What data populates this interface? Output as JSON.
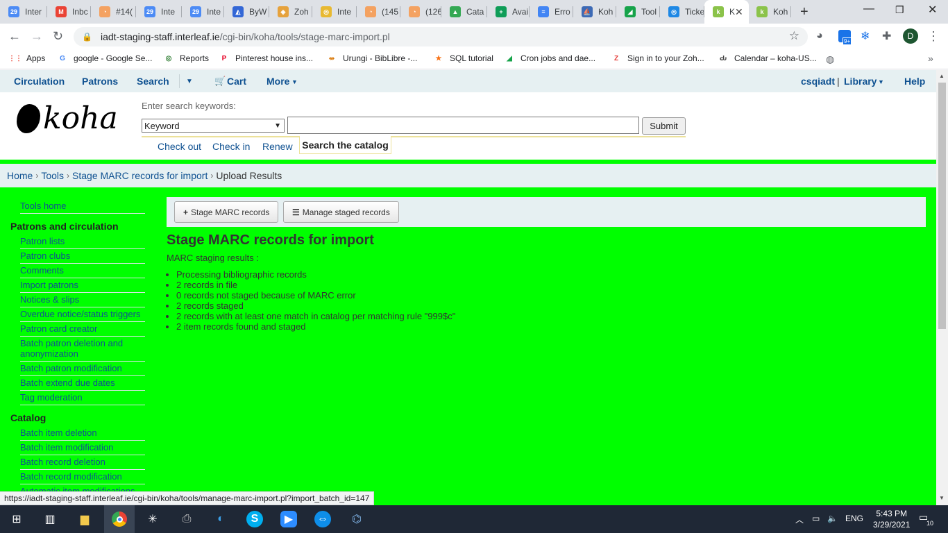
{
  "browser": {
    "tabs": [
      {
        "title": "Inter",
        "color": "#4c8bf5",
        "glyph": "29"
      },
      {
        "title": "Inbc",
        "color": "#ea4335",
        "glyph": "M"
      },
      {
        "title": "#14(",
        "color": "#f4a261",
        "glyph": "◔"
      },
      {
        "title": "Inte",
        "color": "#4c8bf5",
        "glyph": "29"
      },
      {
        "title": "Inte",
        "color": "#4c8bf5",
        "glyph": "29"
      },
      {
        "title": "ByW",
        "color": "#3367d6",
        "glyph": "◭"
      },
      {
        "title": "Zoh",
        "color": "#e6a23c",
        "glyph": "◈"
      },
      {
        "title": "Inte",
        "color": "#e8b931",
        "glyph": "◎"
      },
      {
        "title": "(145",
        "color": "#f4a261",
        "glyph": "◔"
      },
      {
        "title": "(126",
        "color": "#f4a261",
        "glyph": "◔"
      },
      {
        "title": "Cata",
        "color": "#34a853",
        "glyph": "▲"
      },
      {
        "title": "Avai",
        "color": "#0f9d58",
        "glyph": "+"
      },
      {
        "title": "Erro",
        "color": "#4285f4",
        "glyph": "≡"
      },
      {
        "title": "Koh",
        "color": "#3d6ab5",
        "glyph": "⛵"
      },
      {
        "title": "Tool",
        "color": "#16a34a",
        "glyph": "◢"
      },
      {
        "title": "Ticke",
        "color": "#1e88e5",
        "glyph": "◎"
      },
      {
        "title": "K",
        "color": "#8bc34a",
        "glyph": "k",
        "active": true
      },
      {
        "title": "Koh",
        "color": "#8bc34a",
        "glyph": "k"
      }
    ],
    "url_host": "iadt-staging-staff.interleaf.ie",
    "url_path": "/cgi-bin/koha/tools/stage-marc-import.pl",
    "bookmarks": [
      {
        "label": "Apps",
        "icon": "apps-grid-icon",
        "color": "#ea4335",
        "glyph": "⋮⋮"
      },
      {
        "label": "google - Google Se...",
        "icon": "google-icon",
        "color": "#4285f4",
        "glyph": "G"
      },
      {
        "label": "Reports",
        "icon": "reports-icon",
        "color": "#2e7d32",
        "glyph": "◎"
      },
      {
        "label": "Pinterest house ins...",
        "icon": "pinterest-icon",
        "color": "#e60023",
        "glyph": "P"
      },
      {
        "label": "Urungi - BibLibre -...",
        "icon": "urungi-icon",
        "color": "#d97706",
        "glyph": "⥈"
      },
      {
        "label": "SQL tutorial",
        "icon": "star-icon",
        "color": "#f97316",
        "glyph": "★"
      },
      {
        "label": "Cron jobs and dae...",
        "icon": "cron-icon",
        "color": "#16a34a",
        "glyph": "◢"
      },
      {
        "label": "Sign in to your Zoh...",
        "icon": "zoho-icon",
        "color": "#e53935",
        "glyph": "Z"
      },
      {
        "label": "Calendar – koha-US...",
        "icon": "calendar-icon",
        "color": "#444",
        "glyph": "Ԃ"
      }
    ],
    "status_url": "https://iadt-staging-staff.interleaf.ie/cgi-bin/koha/tools/manage-marc-import.pl?import_batch_id=147",
    "profile_initial": "D",
    "ext_badge": "9+"
  },
  "topnav": {
    "circulation": "Circulation",
    "patrons": "Patrons",
    "search": "Search",
    "cart": "Cart",
    "more": "More",
    "user": "csqiadt",
    "divider": "|",
    "library": "Library",
    "help": "Help"
  },
  "header": {
    "logo": "koha",
    "search_label": "Enter search keywords:",
    "search_type": "Keyword",
    "search_value": "",
    "submit": "Submit",
    "quick_tabs": [
      "Check out",
      "Check in",
      "Renew"
    ],
    "active_tab": "Search the catalog"
  },
  "breadcrumbs": {
    "home": "Home",
    "tools": "Tools",
    "stage": "Stage MARC records for import",
    "current": "Upload Results",
    "separator": "›"
  },
  "sidebar": {
    "tools_home": "Tools home",
    "sections": [
      {
        "heading": "Patrons and circulation",
        "items": [
          "Patron lists",
          "Patron clubs",
          "Comments",
          "Import patrons",
          "Notices & slips",
          "Overdue notice/status triggers",
          "Patron card creator",
          "Batch patron deletion and anonymization",
          "Batch patron modification",
          "Batch extend due dates",
          "Tag moderation"
        ]
      },
      {
        "heading": "Catalog",
        "items": [
          "Batch item deletion",
          "Batch item modification",
          "Batch record deletion",
          "Batch record modification",
          "Automatic item modifications"
        ]
      }
    ]
  },
  "main": {
    "btn_stage": "Stage MARC records",
    "btn_manage": "Manage staged records",
    "title": "Stage MARC records for import",
    "subtitle": "MARC staging results :",
    "results": [
      "Processing bibliographic records",
      "2 records in file",
      "0 records not staged because of MARC error",
      "2 records staged",
      "2 records with at least one match in catalog per matching rule \"999$c\"",
      "2 item records found and staged"
    ]
  },
  "taskbar": {
    "lang": "ENG",
    "time": "5:43 PM",
    "date": "3/29/2021",
    "notif": "10"
  }
}
